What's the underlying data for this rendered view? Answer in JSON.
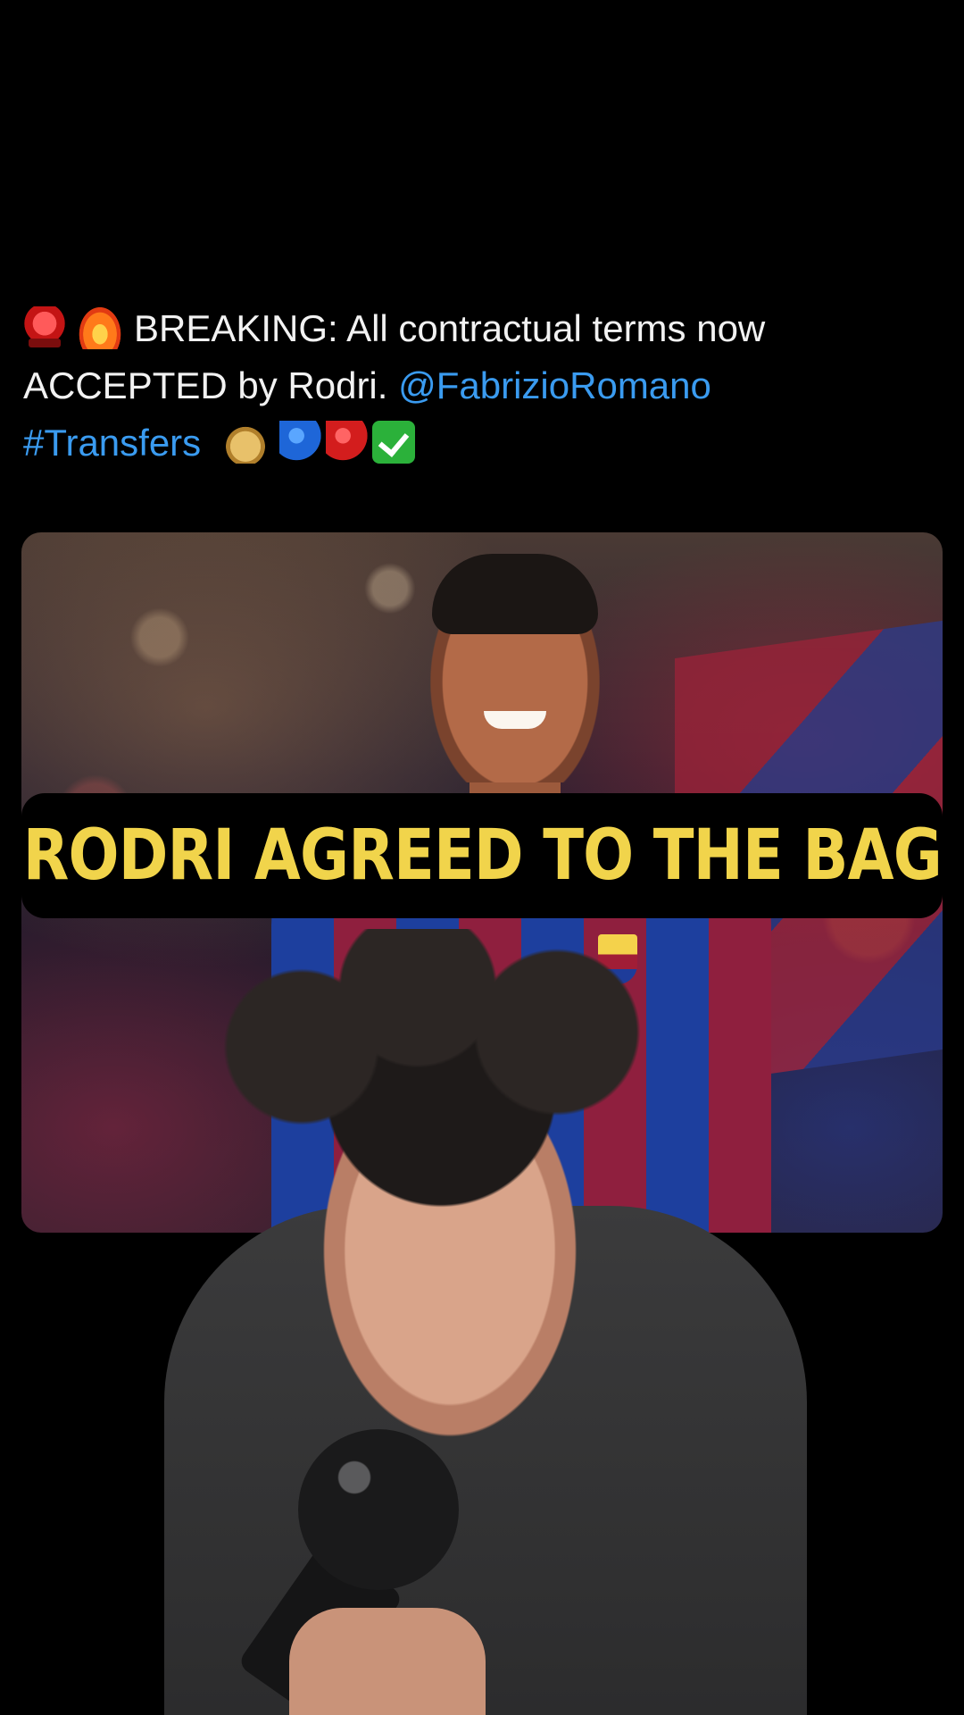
{
  "tweet": {
    "prefix_emojis": [
      "rotating-light",
      "fire"
    ],
    "text": "BREAKING: All contractual terms now ACCEPTED by Rodri. ",
    "mention": "@FabrizioRomano",
    "hashtag": "#Transfers",
    "suffix_emojis": [
      "money-bag",
      "blue-circle",
      "red-circle",
      "check-mark-button"
    ]
  },
  "caption": {
    "text": "RODRI AGREED TO THE BAG",
    "color": "#f1d44b"
  },
  "colors": {
    "background": "#000000",
    "link": "#3a9bf0",
    "text": "#f2f2f2"
  }
}
